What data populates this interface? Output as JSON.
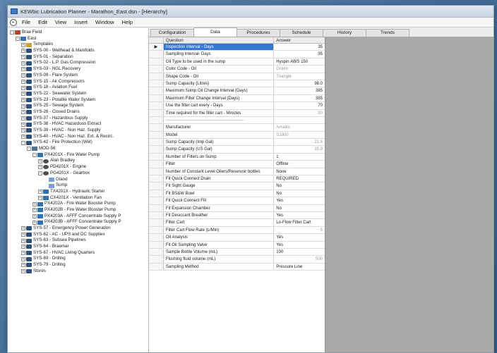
{
  "window": {
    "title": "KEWbic Lubrication Planner - Marathon_East.dsn - [Hierarchy]"
  },
  "menu": {
    "items": [
      "File",
      "Edit",
      "View",
      "Insert",
      "Window",
      "Help"
    ]
  },
  "tree": {
    "nodes": [
      {
        "label": "Brae Field",
        "depth": 0,
        "exp": "−",
        "icon": "field"
      },
      {
        "label": "East",
        "depth": 1,
        "exp": "−",
        "icon": "area"
      },
      {
        "label": "Templates",
        "depth": 2,
        "exp": "+",
        "icon": "templ"
      },
      {
        "label": "SYS-00 - Wellhead & Manifolds",
        "depth": 2,
        "exp": "+",
        "icon": "sys"
      },
      {
        "label": "SYS-01 - Separation",
        "depth": 2,
        "exp": "+",
        "icon": "sys"
      },
      {
        "label": "SYS-02 - L.P. Gas Compression",
        "depth": 2,
        "exp": "+",
        "icon": "sys"
      },
      {
        "label": "SYS-03 - NGL Recovery",
        "depth": 2,
        "exp": "+",
        "icon": "sys"
      },
      {
        "label": "SYS-09 - Flare System",
        "depth": 2,
        "exp": "+",
        "icon": "sys"
      },
      {
        "label": "SYS-15 - Air Compressors",
        "depth": 2,
        "exp": "+",
        "icon": "sys"
      },
      {
        "label": "SYS-18 - Aviation Fuel",
        "depth": 2,
        "exp": "+",
        "icon": "sys"
      },
      {
        "label": "SYS-22 - Seawater System",
        "depth": 2,
        "exp": "+",
        "icon": "sys"
      },
      {
        "label": "SYS-23 - Potable Water System",
        "depth": 2,
        "exp": "+",
        "icon": "sys"
      },
      {
        "label": "SYS-25 - Sewage System",
        "depth": 2,
        "exp": "+",
        "icon": "sys"
      },
      {
        "label": "SYS-26 - Closed Drains",
        "depth": 2,
        "exp": "+",
        "icon": "sys"
      },
      {
        "label": "SYS-37 - Hazardous Supply",
        "depth": 2,
        "exp": "+",
        "icon": "sys"
      },
      {
        "label": "SYS-38 - HVAC Hazardous Extract",
        "depth": 2,
        "exp": "+",
        "icon": "sys"
      },
      {
        "label": "SYS-39 - HVAC - Non Haz. Supply",
        "depth": 2,
        "exp": "+",
        "icon": "sys"
      },
      {
        "label": "SYS-40 - HVAC - Non Haz. Ext. & Recirc.",
        "depth": 2,
        "exp": "+",
        "icon": "sys"
      },
      {
        "label": "SYS-42 - Fire Protection (Wet)",
        "depth": 2,
        "exp": "−",
        "icon": "sys"
      },
      {
        "label": "MOD-56",
        "depth": 3,
        "exp": "−",
        "icon": "mod"
      },
      {
        "label": "PX4201X - Fire Water Pump",
        "depth": 4,
        "exp": "−",
        "icon": "pump"
      },
      {
        "label": "Alan Bradley",
        "depth": 5,
        "exp": "+",
        "icon": "motor"
      },
      {
        "label": "PD4201X - Engine",
        "depth": 5,
        "exp": "+",
        "icon": "motor"
      },
      {
        "label": "PG4201X - Gearbox",
        "depth": 5,
        "exp": "−",
        "icon": "motor"
      },
      {
        "label": "Gland",
        "depth": 6,
        "exp": "",
        "icon": "sump"
      },
      {
        "label": "Sump",
        "depth": 6,
        "exp": "",
        "icon": "sump"
      },
      {
        "label": "TX4201X - Hydraulic Starter",
        "depth": 5,
        "exp": "+",
        "icon": "pump"
      },
      {
        "label": "CX4201X - Ventilation Fan",
        "depth": 5,
        "exp": "+",
        "icon": "pump"
      },
      {
        "label": "PX4202A - Fire Water Booster Pump",
        "depth": 4,
        "exp": "+",
        "icon": "pump"
      },
      {
        "label": "PX4202B - Fire Water Booster Pump",
        "depth": 4,
        "exp": "+",
        "icon": "pump"
      },
      {
        "label": "PX4203A - AFFF Concentrate Supply P",
        "depth": 4,
        "exp": "+",
        "icon": "pump"
      },
      {
        "label": "PX4203B - AFFF Concentrate Supply P",
        "depth": 4,
        "exp": "+",
        "icon": "pump"
      },
      {
        "label": "SYS-57 - Emergency Power Generation",
        "depth": 2,
        "exp": "+",
        "icon": "sys"
      },
      {
        "label": "SYS-62 - AC - UPS and DC Supplies",
        "depth": 2,
        "exp": "+",
        "icon": "sys"
      },
      {
        "label": "SYS-63 - Subsea Pipelines",
        "depth": 2,
        "exp": "+",
        "icon": "sys"
      },
      {
        "label": "SYS-64 - Braemar",
        "depth": 2,
        "exp": "+",
        "icon": "sys"
      },
      {
        "label": "SYS-67 - HVAC Living Quarters",
        "depth": 2,
        "exp": "+",
        "icon": "sys"
      },
      {
        "label": "SYS-69 - Drilling",
        "depth": 2,
        "exp": "+",
        "icon": "sys"
      },
      {
        "label": "SYS-79 - Drilling",
        "depth": 2,
        "exp": "+",
        "icon": "sys"
      },
      {
        "label": "Stores",
        "depth": 2,
        "exp": "+",
        "icon": "sys"
      }
    ]
  },
  "tabs": [
    "Configuration",
    "Data",
    "Procedures",
    "Schedule",
    "History",
    "Trends"
  ],
  "active_tab": "Data",
  "grid": {
    "columns": {
      "question": "Question",
      "answer": "Answer"
    },
    "rows": [
      {
        "q": "Inspection Interval - Days",
        "a": "35",
        "align": "num",
        "hl": true,
        "marker": "▶"
      },
      {
        "q": "Sampling Interval- Days",
        "a": "35",
        "align": "num"
      },
      {
        "q": "Oil Type to be used in the sump",
        "a": "Hyspin AWS 150",
        "align": "text"
      },
      {
        "q": "Color Code - Oil",
        "a": "Green",
        "align": "text",
        "grey": true
      },
      {
        "q": "Shape Code - Oil",
        "a": "Triangle",
        "align": "text",
        "grey": true
      },
      {
        "q": "Sump Capacity (Litres)",
        "a": "98.0",
        "align": "num"
      },
      {
        "q": "Maximum Sump Oil Change Interval (Days)",
        "a": "385",
        "align": "num"
      },
      {
        "q": "Maximum Filter Change Interval (Days)",
        "a": "385",
        "align": "num"
      },
      {
        "q": "Use the filter cart every - Days",
        "a": "70",
        "align": "num"
      },
      {
        "q": "Time required for the filter cart - Minutes",
        "a": "90",
        "align": "num",
        "grey": true
      },
      {
        "q": "————————————————————",
        "a": "",
        "align": "text",
        "sep": true
      },
      {
        "q": "Manufacturer",
        "a": "Amaillo",
        "align": "text",
        "grey": true
      },
      {
        "q": "Model",
        "a": "S1800",
        "align": "text",
        "grey": true
      },
      {
        "q": "Sump Capacity (Imp Gal)",
        "a": "21.6",
        "align": "num",
        "grey": true
      },
      {
        "q": "Sump Capacity (US Gal)",
        "a": "25.9",
        "align": "num",
        "grey": true
      },
      {
        "q": "Number of Filters on Sump",
        "a": "1",
        "align": "text"
      },
      {
        "q": "Filter",
        "a": "Offline",
        "align": "text"
      },
      {
        "q": "Number of Constant Level Oilers/Reservoir bottles",
        "a": "None",
        "align": "text"
      },
      {
        "q": "Fit Quick Connect Drain",
        "a": "REQUIRED",
        "align": "text"
      },
      {
        "q": "Fit Sight Gauge",
        "a": "No",
        "align": "text"
      },
      {
        "q": "Fit BS&W Bowl",
        "a": "No",
        "align": "text"
      },
      {
        "q": "Fit Quick Connect Fill",
        "a": "Yes",
        "align": "text"
      },
      {
        "q": "Fit Expansion Chamber",
        "a": "No",
        "align": "text"
      },
      {
        "q": "Fit Desiccant Breather",
        "a": "Yes",
        "align": "text"
      },
      {
        "q": "Filter Cart",
        "a": "Lo-Flow Filter Cart",
        "align": "text"
      },
      {
        "q": "Filter Cart Flow Rate (L/Min)",
        "a": "5",
        "align": "num",
        "grey": true
      },
      {
        "q": "Oil Analysis",
        "a": "Yes",
        "align": "text"
      },
      {
        "q": "Fit Oil Sampling Valve",
        "a": "Yes",
        "align": "text"
      },
      {
        "q": "Sample Bottle Volume (mL)",
        "a": "100",
        "align": "text"
      },
      {
        "q": "Flushing fluid volume (mL)",
        "a": "500",
        "align": "num",
        "grey": true
      },
      {
        "q": "Sampling Method",
        "a": "Pressure Line",
        "align": "text"
      }
    ]
  }
}
